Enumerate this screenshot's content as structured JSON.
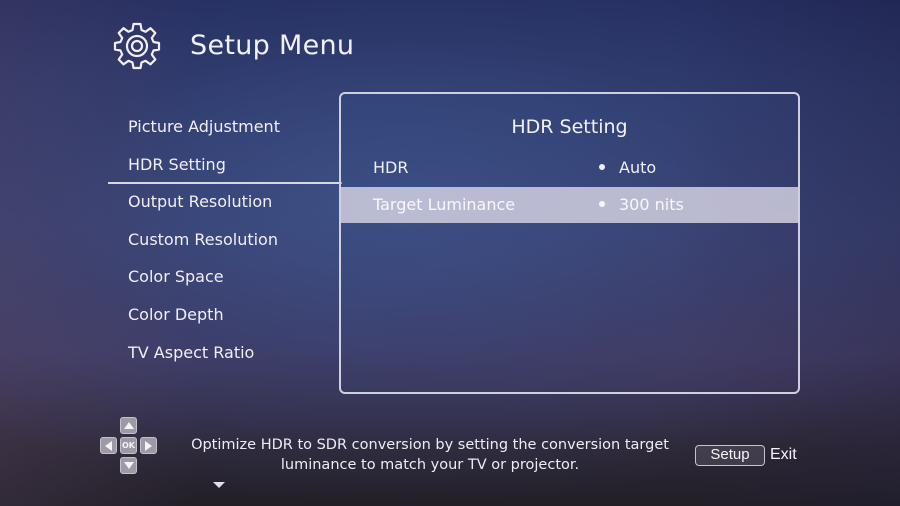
{
  "header": {
    "icon": "gear-icon",
    "title": "Setup Menu"
  },
  "sidebar": {
    "selected_index": 1,
    "items": [
      {
        "label": "Picture Adjustment"
      },
      {
        "label": "HDR Setting"
      },
      {
        "label": "Output Resolution"
      },
      {
        "label": "Custom Resolution"
      },
      {
        "label": "Color Space"
      },
      {
        "label": "Color Depth"
      },
      {
        "label": "TV Aspect Ratio"
      }
    ],
    "more_indicator": "chevron-down-icon"
  },
  "panel": {
    "title": "HDR Setting",
    "rows": [
      {
        "label": "HDR",
        "value": "Auto",
        "highlighted": false
      },
      {
        "label": "Target Luminance",
        "value": "300 nits",
        "highlighted": true
      }
    ]
  },
  "footer": {
    "dpad": {
      "up": "arrow-up-icon",
      "down": "arrow-down-icon",
      "left": "arrow-left-icon",
      "right": "arrow-right-icon",
      "ok_label": "OK"
    },
    "help_line1": "Optimize HDR to SDR conversion by setting the conversion target",
    "help_line2": "luminance to match your TV or projector.",
    "setup_button_label": "Setup",
    "exit_label": "Exit"
  }
}
